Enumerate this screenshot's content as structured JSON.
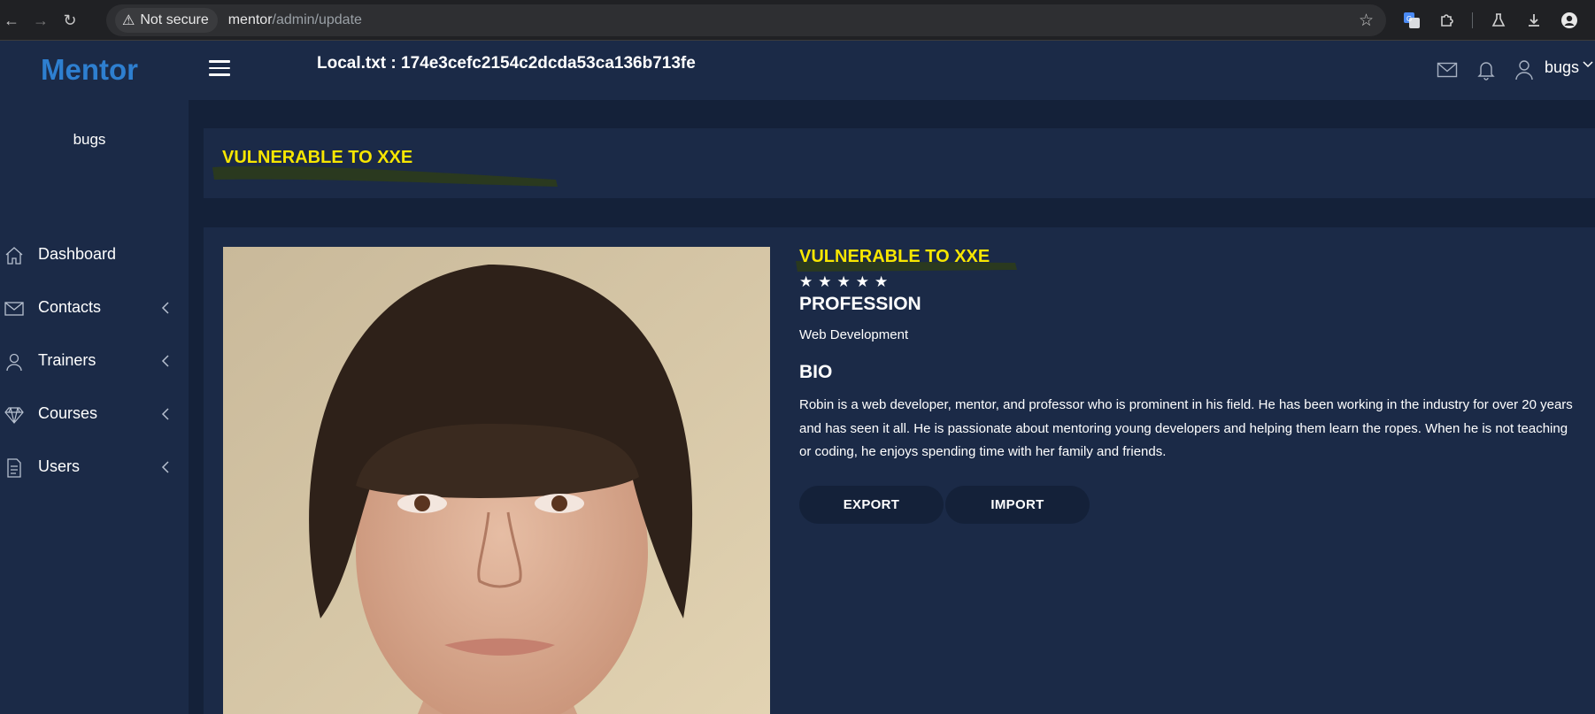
{
  "browser": {
    "security_label": "Not secure",
    "url_host": "mentor",
    "url_path": "/admin/update"
  },
  "header": {
    "brand": "Mentor",
    "local_txt": "Local.txt : 174e3cefc2154c2dcda53ca136b713fe",
    "user": "bugs"
  },
  "sidebar": {
    "user": "bugs",
    "items": [
      {
        "label": "Dashboard",
        "icon": "home-icon"
      },
      {
        "label": "Contacts",
        "icon": "envelope-icon"
      },
      {
        "label": "Trainers",
        "icon": "user-icon"
      },
      {
        "label": "Courses",
        "icon": "diamond-icon"
      },
      {
        "label": "Users",
        "icon": "document-icon"
      }
    ]
  },
  "main": {
    "banner_title": "VULNERABLE TO XXE",
    "profile": {
      "name": "VULNERABLE TO XXE",
      "rating": 5,
      "profession_heading": "PROFESSION",
      "profession": "Web Development",
      "bio_heading": "BIO",
      "bio": "Robin is a web developer, mentor, and professor who is prominent in his field. He has been working in the industry for over 20 years and has seen it all. He is passionate about mentoring young developers and helping them learn the ropes. When he is not teaching or coding, he enjoys spending time with her family and friends.",
      "export_label": "EXPORT",
      "import_label": "IMPORT"
    }
  },
  "colors": {
    "brand": "#2e7fd0",
    "highlight_text": "#f7e600",
    "panel": "#1b2a47",
    "background": "#142139"
  }
}
